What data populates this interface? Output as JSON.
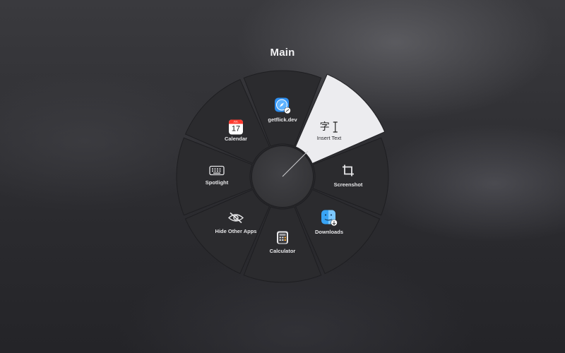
{
  "menu": {
    "title": "Main",
    "items": [
      {
        "label": "getflick.dev",
        "icon": "safari-link-icon"
      },
      {
        "label": "Insert Text",
        "icon": "insert-text-icon",
        "selected": true
      },
      {
        "label": "Screenshot",
        "icon": "crop-icon"
      },
      {
        "label": "Downloads",
        "icon": "finder-downloads-icon"
      },
      {
        "label": "Calculator",
        "icon": "calculator-icon"
      },
      {
        "label": "Hide Other Apps",
        "icon": "eye-slash-icon"
      },
      {
        "label": "Spotlight",
        "icon": "keyboard-icon"
      },
      {
        "label": "Calendar",
        "icon": "calendar-icon"
      }
    ],
    "calendar_month": "JUL",
    "calendar_day": "17",
    "insert_text_glyph": "字"
  },
  "colors": {
    "segment": "#2b2b2e",
    "segment_selected": "#ececef",
    "center": "#3a3a3d",
    "title": "#f2f2f4"
  }
}
